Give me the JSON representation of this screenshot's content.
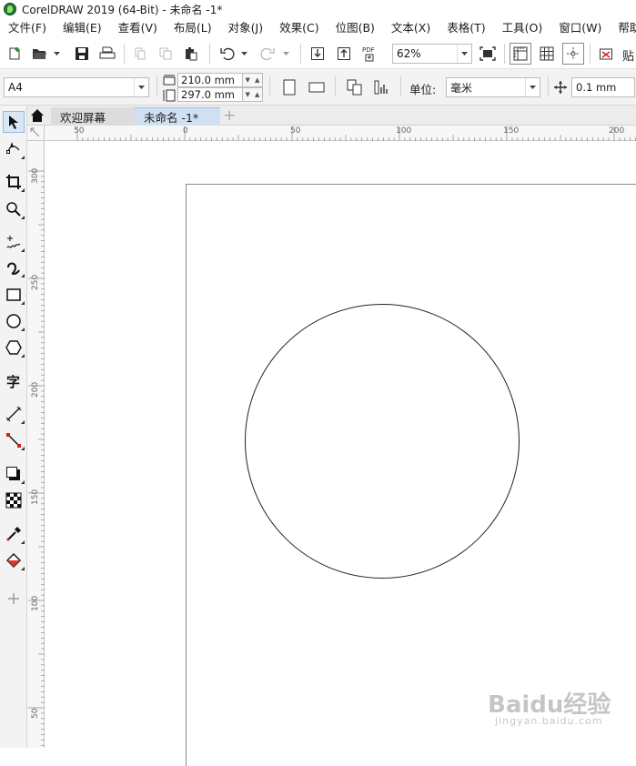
{
  "window": {
    "title": "CorelDRAW 2019 (64-Bit) - 未命名 -1*"
  },
  "menu": [
    "文件(F)",
    "编辑(E)",
    "查看(V)",
    "布局(L)",
    "对象(J)",
    "效果(C)",
    "位图(B)",
    "文本(X)",
    "表格(T)",
    "工具(O)",
    "窗口(W)",
    "帮助("
  ],
  "toolbar": {
    "pdf_label": "PDF",
    "zoom": "62%",
    "paste_label": "贴"
  },
  "properties": {
    "page_size": "A4",
    "width": "210.0 mm",
    "height": "297.0 mm",
    "units_label": "单位:",
    "units": "毫米",
    "nudge": "0.1 mm"
  },
  "tabs": {
    "welcome": "欢迎屏幕",
    "document": "未命名 -1*",
    "add": "+"
  },
  "rulers": {
    "horizontal": [
      "50",
      "0",
      "50",
      "100",
      "150",
      "200"
    ],
    "vertical": [
      "300",
      "250",
      "200",
      "150",
      "100",
      "50"
    ]
  },
  "watermark": {
    "brand": "Baidu经验",
    "url": "jingyan.baidu.com"
  },
  "colors": {
    "accent": "#1f7a3a",
    "tab_active": "#cfe0f3"
  }
}
